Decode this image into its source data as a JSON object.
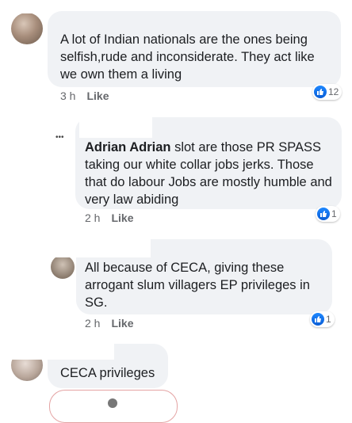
{
  "comments": [
    {
      "author": "",
      "text": "A lot of Indian nationals are the ones being selfish,rude and inconsiderate. They act like we own them a living",
      "time": "3 h",
      "like_label": "Like",
      "reaction_count": "12"
    },
    {
      "author": "Adrian Adrian",
      "text": " slot are those PR SPASS taking our white collar jobs jerks. Those that do labour Jobs are mostly humble and very law abiding",
      "time": "2 h",
      "like_label": "Like",
      "reaction_count": "1"
    },
    {
      "author": "",
      "text": "All because of CECA, giving these arrogant slum villagers EP privileges in SG.",
      "time": "2 h",
      "like_label": "Like",
      "reaction_count": "1"
    },
    {
      "author": "",
      "text": "CECA privileges",
      "time": "",
      "like_label": "",
      "reaction_count": ""
    }
  ],
  "icons": {
    "reaction": "like-thumb-icon",
    "avatar": "user-avatar-icon"
  },
  "colors": {
    "bubble": "#f0f2f5",
    "like_blue": "#1877f2",
    "meta_text": "#65676b"
  }
}
